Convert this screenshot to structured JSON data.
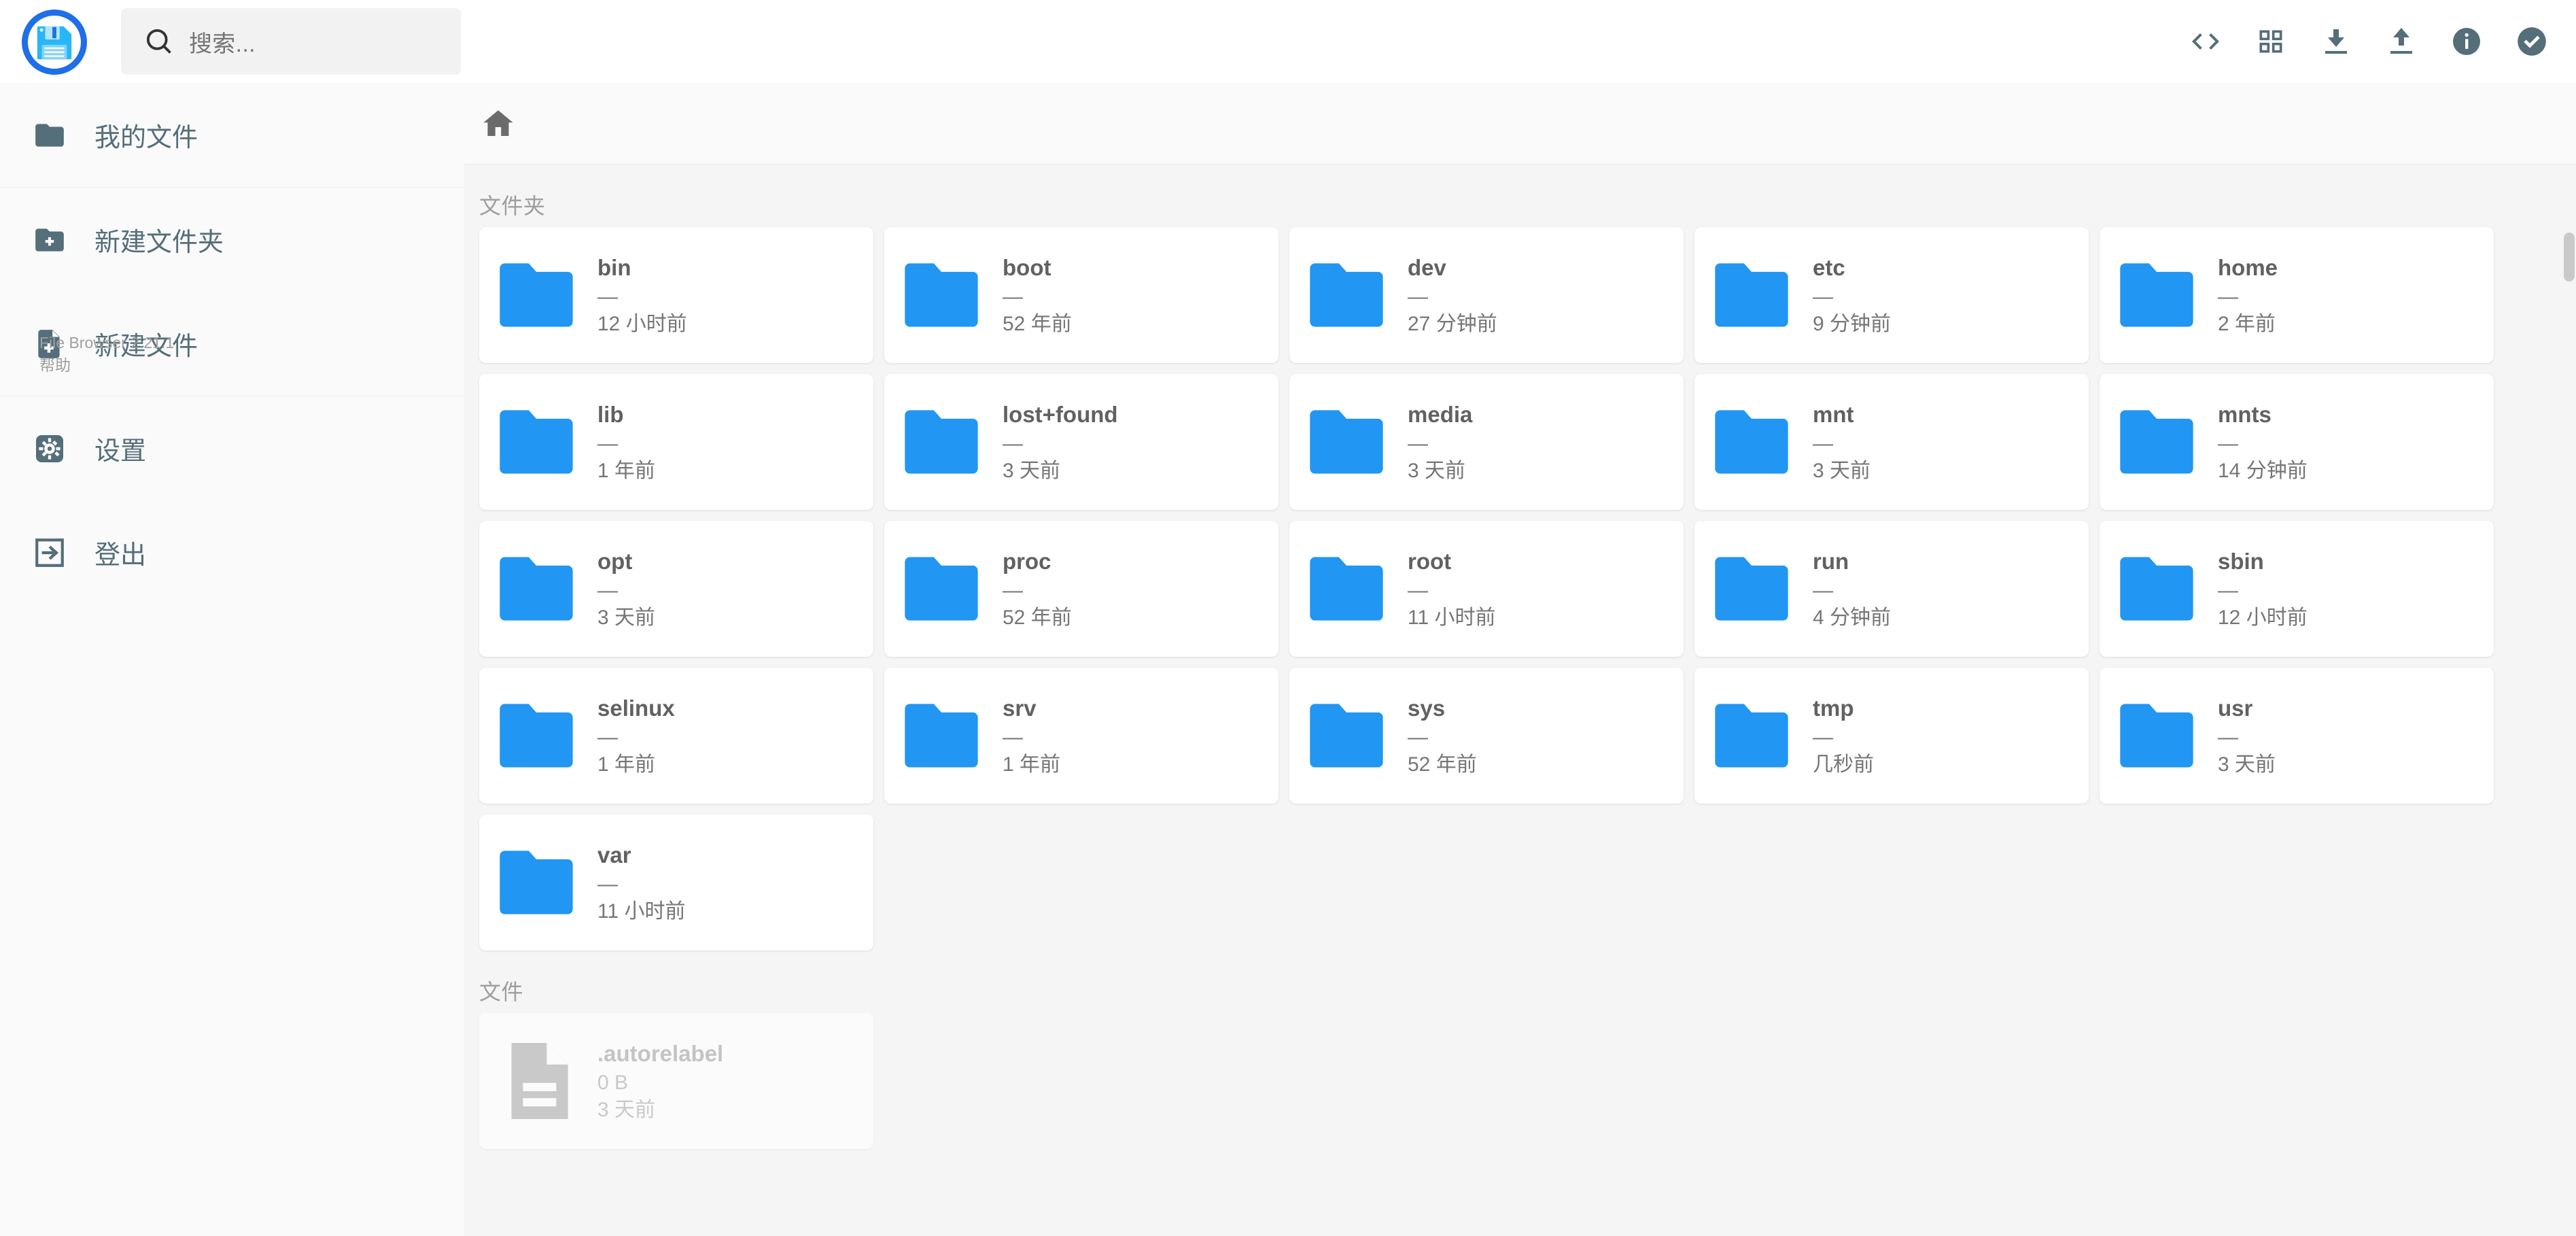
{
  "app": {
    "logo_icon": "floppy-disk-icon",
    "version_label": "File Browser 2.21.1",
    "help_label": "帮助"
  },
  "search": {
    "icon": "search-icon",
    "placeholder": "搜索..."
  },
  "header_actions": [
    {
      "name": "shell-toggle-button",
      "icon": "code-brackets-icon",
      "title": "<>"
    },
    {
      "name": "switch-view-button",
      "icon": "grid-view-icon",
      "title": "切换视图"
    },
    {
      "name": "download-button",
      "icon": "download-icon",
      "title": "下载"
    },
    {
      "name": "upload-button",
      "icon": "upload-icon",
      "title": "上传"
    },
    {
      "name": "info-button",
      "icon": "info-icon",
      "title": "信息"
    },
    {
      "name": "select-multiple-button",
      "icon": "check-circle-icon",
      "title": "选择多个"
    }
  ],
  "sidebar": {
    "items": [
      {
        "label": "我的文件",
        "icon": "folder-icon",
        "name": "sidebar-item-my-files"
      },
      {
        "label": "新建文件夹",
        "icon": "folder-plus-icon",
        "name": "sidebar-item-new-folder"
      },
      {
        "label": "新建文件",
        "icon": "file-plus-icon",
        "name": "sidebar-item-new-file"
      },
      {
        "label": "设置",
        "icon": "gear-icon",
        "name": "sidebar-item-settings"
      },
      {
        "label": "登出",
        "icon": "logout-icon",
        "name": "sidebar-item-logout"
      }
    ]
  },
  "breadcrumb": {
    "home_icon": "home-icon",
    "home_label": ""
  },
  "listing": {
    "folders_heading": "文件夹",
    "files_heading": "文件",
    "folders": [
      {
        "name": "bin",
        "size": "—",
        "time": "12 小时前"
      },
      {
        "name": "boot",
        "size": "—",
        "time": "52 年前"
      },
      {
        "name": "dev",
        "size": "—",
        "time": "27 分钟前"
      },
      {
        "name": "etc",
        "size": "—",
        "time": "9 分钟前"
      },
      {
        "name": "home",
        "size": "—",
        "time": "2 年前"
      },
      {
        "name": "lib",
        "size": "—",
        "time": "1 年前"
      },
      {
        "name": "lost+found",
        "size": "—",
        "time": "3 天前"
      },
      {
        "name": "media",
        "size": "—",
        "time": "3 天前"
      },
      {
        "name": "mnt",
        "size": "—",
        "time": "3 天前"
      },
      {
        "name": "mnts",
        "size": "—",
        "time": "14 分钟前"
      },
      {
        "name": "opt",
        "size": "—",
        "time": "3 天前"
      },
      {
        "name": "proc",
        "size": "—",
        "time": "52 年前"
      },
      {
        "name": "root",
        "size": "—",
        "time": "11 小时前"
      },
      {
        "name": "run",
        "size": "—",
        "time": "4 分钟前"
      },
      {
        "name": "sbin",
        "size": "—",
        "time": "12 小时前"
      },
      {
        "name": "selinux",
        "size": "—",
        "time": "1 年前"
      },
      {
        "name": "srv",
        "size": "—",
        "time": "1 年前"
      },
      {
        "name": "sys",
        "size": "—",
        "time": "52 年前"
      },
      {
        "name": "tmp",
        "size": "—",
        "time": "几秒前"
      },
      {
        "name": "usr",
        "size": "—",
        "time": "3 天前"
      },
      {
        "name": "var",
        "size": "—",
        "time": "11 小时前"
      }
    ],
    "files": [
      {
        "name": ".autorelabel",
        "size": "0 B",
        "time": "3 天前",
        "muted": true
      }
    ]
  },
  "colors": {
    "accent": "#1e6fe8",
    "folder": "#2196f3",
    "icon": "#546e7a",
    "page_bg": "#f5f5f5",
    "sidebar_bg": "#fafafa"
  }
}
